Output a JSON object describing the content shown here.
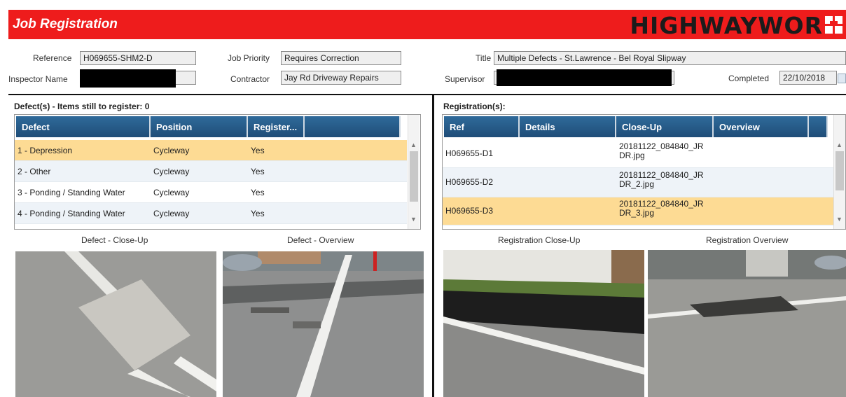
{
  "header": {
    "title": "Job Registration",
    "brand": "HIGHWAYWOR"
  },
  "form": {
    "reference_label": "Reference",
    "reference_value": "H069655-SHM2-D",
    "inspector_label": "Inspector Name",
    "job_priority_label": "Job Priority",
    "job_priority_value": "Requires Correction",
    "contractor_label": "Contractor",
    "contractor_value": "Jay Rd Driveway Repairs",
    "title_label": "Title",
    "title_value": "Multiple Defects - St.Lawrence - Bel Royal Slipway",
    "supervisor_label": "Supervisor",
    "completed_label": "Completed",
    "completed_value": "22/10/2018"
  },
  "defects": {
    "section_title": "Defect(s) - Items still to register: 0",
    "columns": [
      "Defect",
      "Position",
      "Register...",
      ""
    ],
    "rows": [
      {
        "defect": "1 - Depression",
        "position": "Cycleway",
        "register": "Yes"
      },
      {
        "defect": "2 - Other",
        "position": "Cycleway",
        "register": "Yes"
      },
      {
        "defect": "3 - Ponding / Standing Water",
        "position": "Cycleway",
        "register": "Yes"
      },
      {
        "defect": "4 - Ponding / Standing Water",
        "position": "Cycleway",
        "register": "Yes"
      }
    ],
    "closeup_label": "Defect - Close-Up",
    "overview_label": "Defect - Overview"
  },
  "registrations": {
    "section_title": "Registration(s):",
    "columns": [
      "Ref",
      "Details",
      "Close-Up",
      "Overview",
      ""
    ],
    "rows": [
      {
        "ref": "H069655-D1",
        "details": "",
        "closeup_1": "20181122_084840_JR",
        "closeup_2": "DR.jpg",
        "overview": ""
      },
      {
        "ref": "H069655-D2",
        "details": "",
        "closeup_1": "20181122_084840_JR",
        "closeup_2": "DR_2.jpg",
        "overview": ""
      },
      {
        "ref": "H069655-D3",
        "details": "",
        "closeup_1": "20181122_084840_JR",
        "closeup_2": "DR_3.jpg",
        "overview": ""
      }
    ],
    "closeup_label": "Registration Close-Up",
    "overview_label": "Registration Overview"
  },
  "colors": {
    "header_bg": "#ee1c1c",
    "grid_header": "#1f4d78",
    "selected_row": "#fddb94"
  }
}
